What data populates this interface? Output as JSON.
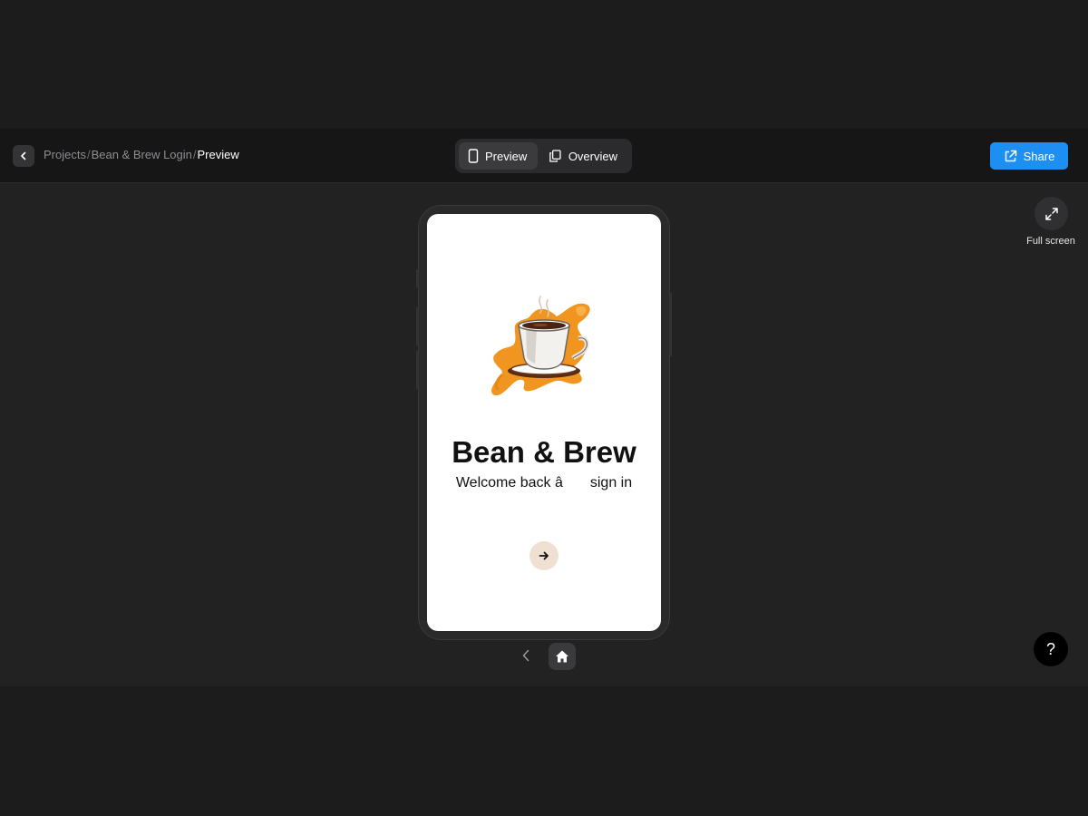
{
  "header": {
    "breadcrumb": [
      "Projects",
      "Bean & Brew Login",
      "Preview"
    ],
    "separator": "/",
    "tabs": [
      {
        "label": "Preview",
        "icon": "phone-icon",
        "active": true
      },
      {
        "label": "Overview",
        "icon": "copy-icon",
        "active": false
      }
    ],
    "share_label": "Share"
  },
  "tools": {
    "fullscreen_label": "Full screen",
    "help_label": "?"
  },
  "app_screen": {
    "title": "Bean & Brew",
    "subtitle": "Welcome back â sign in",
    "logo": "coffee-cup-illustration",
    "submit_icon": "arrow-right-icon"
  },
  "colors": {
    "accent": "#1d8ff2",
    "logo_orange": "#f0951f",
    "button_bg": "#efe0d2"
  }
}
